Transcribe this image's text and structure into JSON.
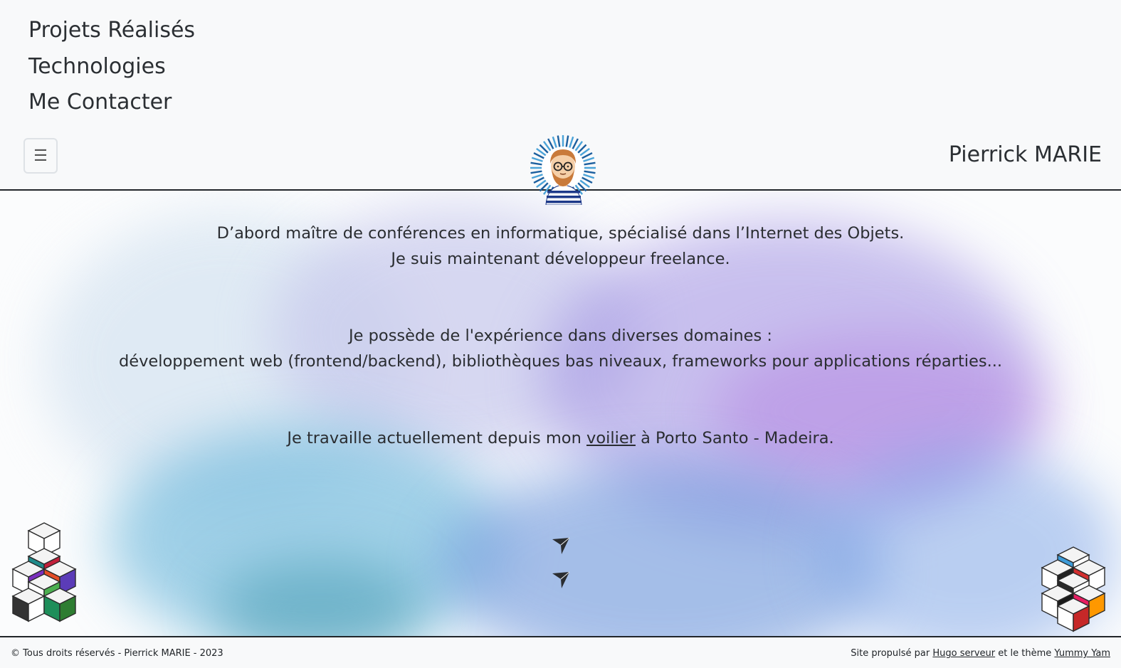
{
  "nav": {
    "items": [
      {
        "label": "Projets Réalisés"
      },
      {
        "label": "Technologies"
      },
      {
        "label": "Me Contacter"
      }
    ],
    "toggle_icon": "hamburger-icon",
    "brand": "Pierrick MARIE"
  },
  "intro": {
    "line1": "D’abord maître de conférences en informatique, spécialisé dans l’Internet des Objets.",
    "line2": "Je suis maintenant développeur freelance.",
    "line3": "Je possède de l'expérience dans diverses domaines :",
    "line4": "développement web (frontend/backend), bibliothèques bas niveaux, frameworks pour applications réparties...",
    "line5_before": "Je travaille actuellement depuis mon",
    "line5_link": "voilier",
    "line5_after": "à Porto Santo - Madeira."
  },
  "footer": {
    "copyright": "© Tous droits réservés - Pierrick MARIE - 2023",
    "powered_prefix": "Site propulsé par",
    "powered_link": "Hugo serveur",
    "theme_prefix": "et le thème",
    "theme_link": "Yummy Yam"
  },
  "colors": {
    "text": "#212529",
    "header_bg": "#f8f9fa",
    "wash_violet": "#8f7ee0",
    "wash_blue": "#5f95d8",
    "wash_cyan": "#55b9d6"
  }
}
